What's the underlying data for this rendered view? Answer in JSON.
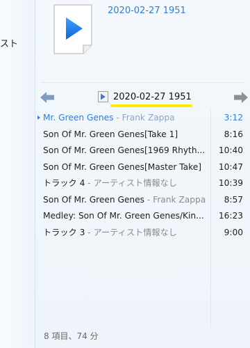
{
  "left_pane": {
    "fragment": "スト"
  },
  "album": {
    "title": "2020-02-27 1951"
  },
  "nav": {
    "title": "2020-02-27 1951"
  },
  "tracks": [
    {
      "title": "Mr. Green Genes",
      "artist": " - Frank Zappa",
      "duration": "3:12",
      "playing": true
    },
    {
      "title": "Son Of Mr. Green Genes[Take 1]",
      "artist": "",
      "duration": "8:16"
    },
    {
      "title": "Son Of Mr. Green Genes[1969 Rhyth...",
      "artist": "",
      "duration": "10:40"
    },
    {
      "title": "Son Of Mr. Green Genes[Master Take]",
      "artist": "",
      "duration": "10:47"
    },
    {
      "title": "トラック 4",
      "artist": " - アーティスト情報なし",
      "duration": "10:39"
    },
    {
      "title": "Son Of Mr. Green Genes",
      "artist": " - Frank Zappa",
      "duration": "8:57"
    },
    {
      "title": "Medley: Son Of Mr. Green Genes/Kin...",
      "artist": "",
      "duration": "16:23"
    },
    {
      "title": "トラック 3",
      "artist": " - アーティスト情報なし",
      "duration": "9:00"
    }
  ],
  "footer": {
    "summary": "8 項目、74 分"
  },
  "colors": {
    "accent": "#2f7ed8",
    "highlight": "#ffee00"
  },
  "icons": {
    "back": "arrow-left-icon",
    "forward": "arrow-right-icon",
    "album_art": "play-document-icon"
  }
}
